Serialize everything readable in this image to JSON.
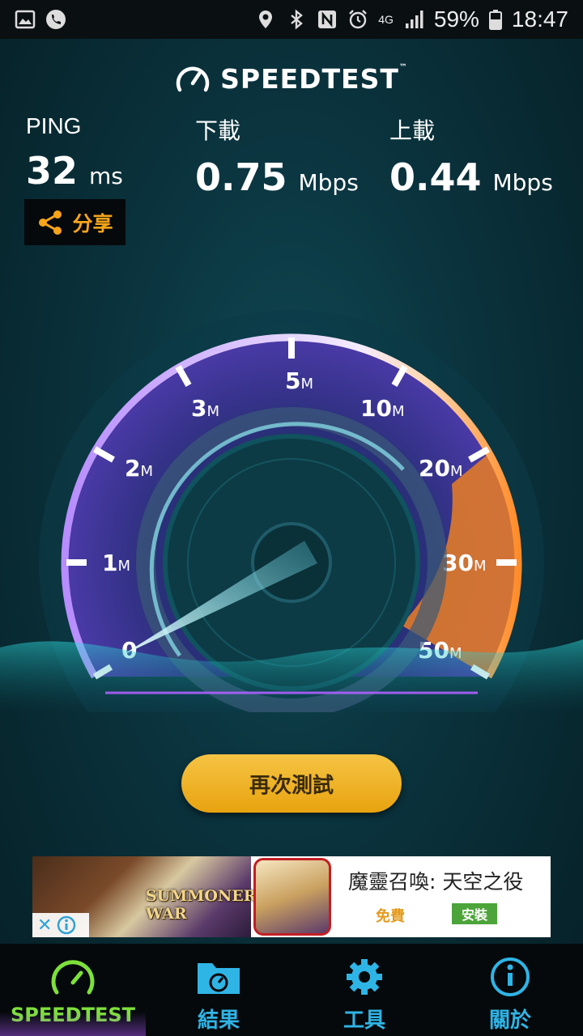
{
  "status_bar": {
    "battery": "59%",
    "time": "18:47",
    "network": "4G"
  },
  "header": {
    "brand": "SPEEDTEST",
    "trademark": "™"
  },
  "stats": {
    "ping": {
      "label": "PING",
      "value": "32",
      "unit": "ms"
    },
    "download": {
      "label": "下載",
      "value": "0.75",
      "unit": "Mbps"
    },
    "upload": {
      "label": "上載",
      "value": "0.44",
      "unit": "Mbps"
    }
  },
  "share": {
    "label": "分享"
  },
  "gauge": {
    "ticks": [
      {
        "num": "0",
        "unit": ""
      },
      {
        "num": "1",
        "unit": "M"
      },
      {
        "num": "2",
        "unit": "M"
      },
      {
        "num": "3",
        "unit": "M"
      },
      {
        "num": "5",
        "unit": "M"
      },
      {
        "num": "10",
        "unit": "M"
      },
      {
        "num": "20",
        "unit": "M"
      },
      {
        "num": "30",
        "unit": "M"
      },
      {
        "num": "50",
        "unit": "M"
      }
    ],
    "needle_value_mbps": 0
  },
  "retest_button": {
    "label": "再次測試"
  },
  "ad": {
    "game_logo": "SUMMONERS WAR",
    "title": "魔靈召喚: 天空之役",
    "price": "免費",
    "install": "安裝"
  },
  "nav": {
    "items": [
      {
        "label": "SPEEDTEST",
        "icon": "speedometer-icon",
        "active": true
      },
      {
        "label": "結果",
        "icon": "results-folder-icon",
        "active": false
      },
      {
        "label": "工具",
        "icon": "gear-icon",
        "active": false
      },
      {
        "label": "關於",
        "icon": "info-icon",
        "active": false
      }
    ]
  },
  "colors": {
    "accent_green": "#7ee03b",
    "accent_blue": "#2fb4e6",
    "button_gold": "#f0b52a",
    "gauge_orange": "#f58a2b",
    "gauge_purple": "#9b5cf0"
  }
}
